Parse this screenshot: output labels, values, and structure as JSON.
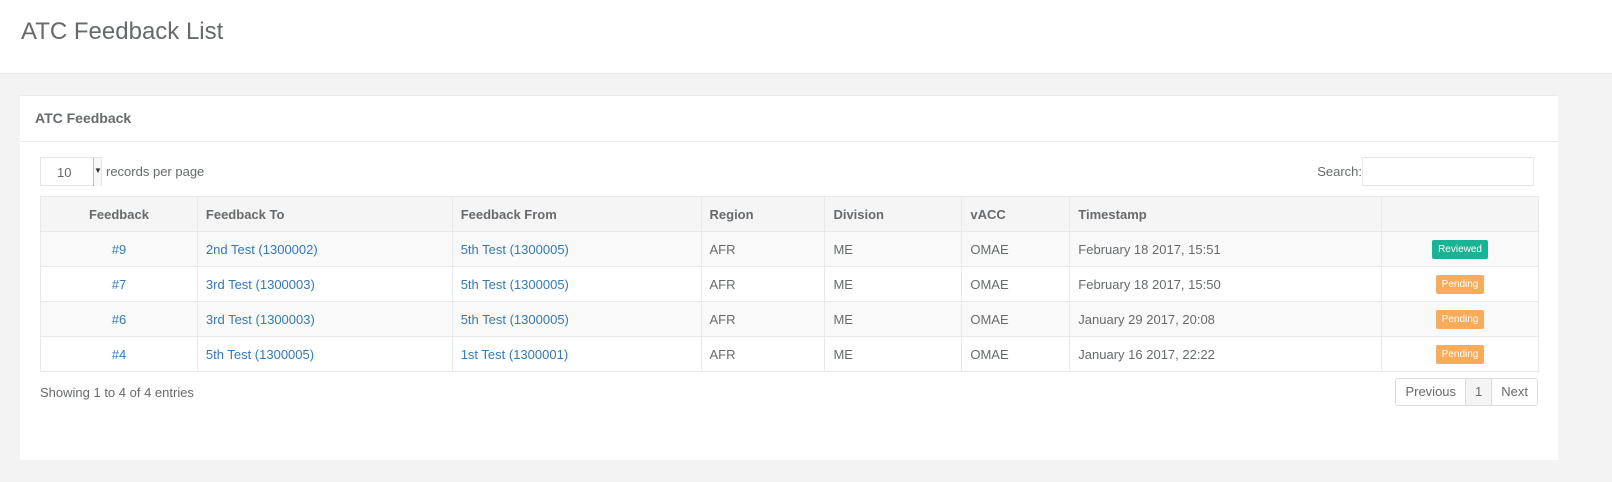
{
  "page": {
    "title": "ATC Feedback List"
  },
  "panel": {
    "title": "ATC Feedback"
  },
  "length": {
    "value": "10",
    "label": "records per page"
  },
  "search": {
    "label": "Search:",
    "value": "",
    "placeholder": ""
  },
  "table": {
    "headers": [
      "Feedback",
      "Feedback To",
      "Feedback From",
      "Region",
      "Division",
      "vACC",
      "Timestamp",
      ""
    ],
    "rows": [
      {
        "id": "#9",
        "to": "2nd Test (1300002)",
        "from": "5th Test (1300005)",
        "region": "AFR",
        "division": "ME",
        "vacc": "OMAE",
        "timestamp": "February 18 2017, 15:51",
        "status": "Reviewed"
      },
      {
        "id": "#7",
        "to": "3rd Test (1300003)",
        "from": "5th Test (1300005)",
        "region": "AFR",
        "division": "ME",
        "vacc": "OMAE",
        "timestamp": "February 18 2017, 15:50",
        "status": "Pending"
      },
      {
        "id": "#6",
        "to": "3rd Test (1300003)",
        "from": "5th Test (1300005)",
        "region": "AFR",
        "division": "ME",
        "vacc": "OMAE",
        "timestamp": "January 29 2017, 20:08",
        "status": "Pending"
      },
      {
        "id": "#4",
        "to": "5th Test (1300005)",
        "from": "1st Test (1300001)",
        "region": "AFR",
        "division": "ME",
        "vacc": "OMAE",
        "timestamp": "January 16 2017, 22:22",
        "status": "Pending"
      }
    ]
  },
  "info": "Showing 1 to 4 of 4 entries",
  "pagination": {
    "previous": "Previous",
    "page": "1",
    "next": "Next"
  },
  "colors": {
    "reviewed": "#1ab394",
    "pending": "#f8ac59",
    "link": "#337ab7"
  },
  "icons": {
    "select_caret": "caret-down-icon"
  }
}
